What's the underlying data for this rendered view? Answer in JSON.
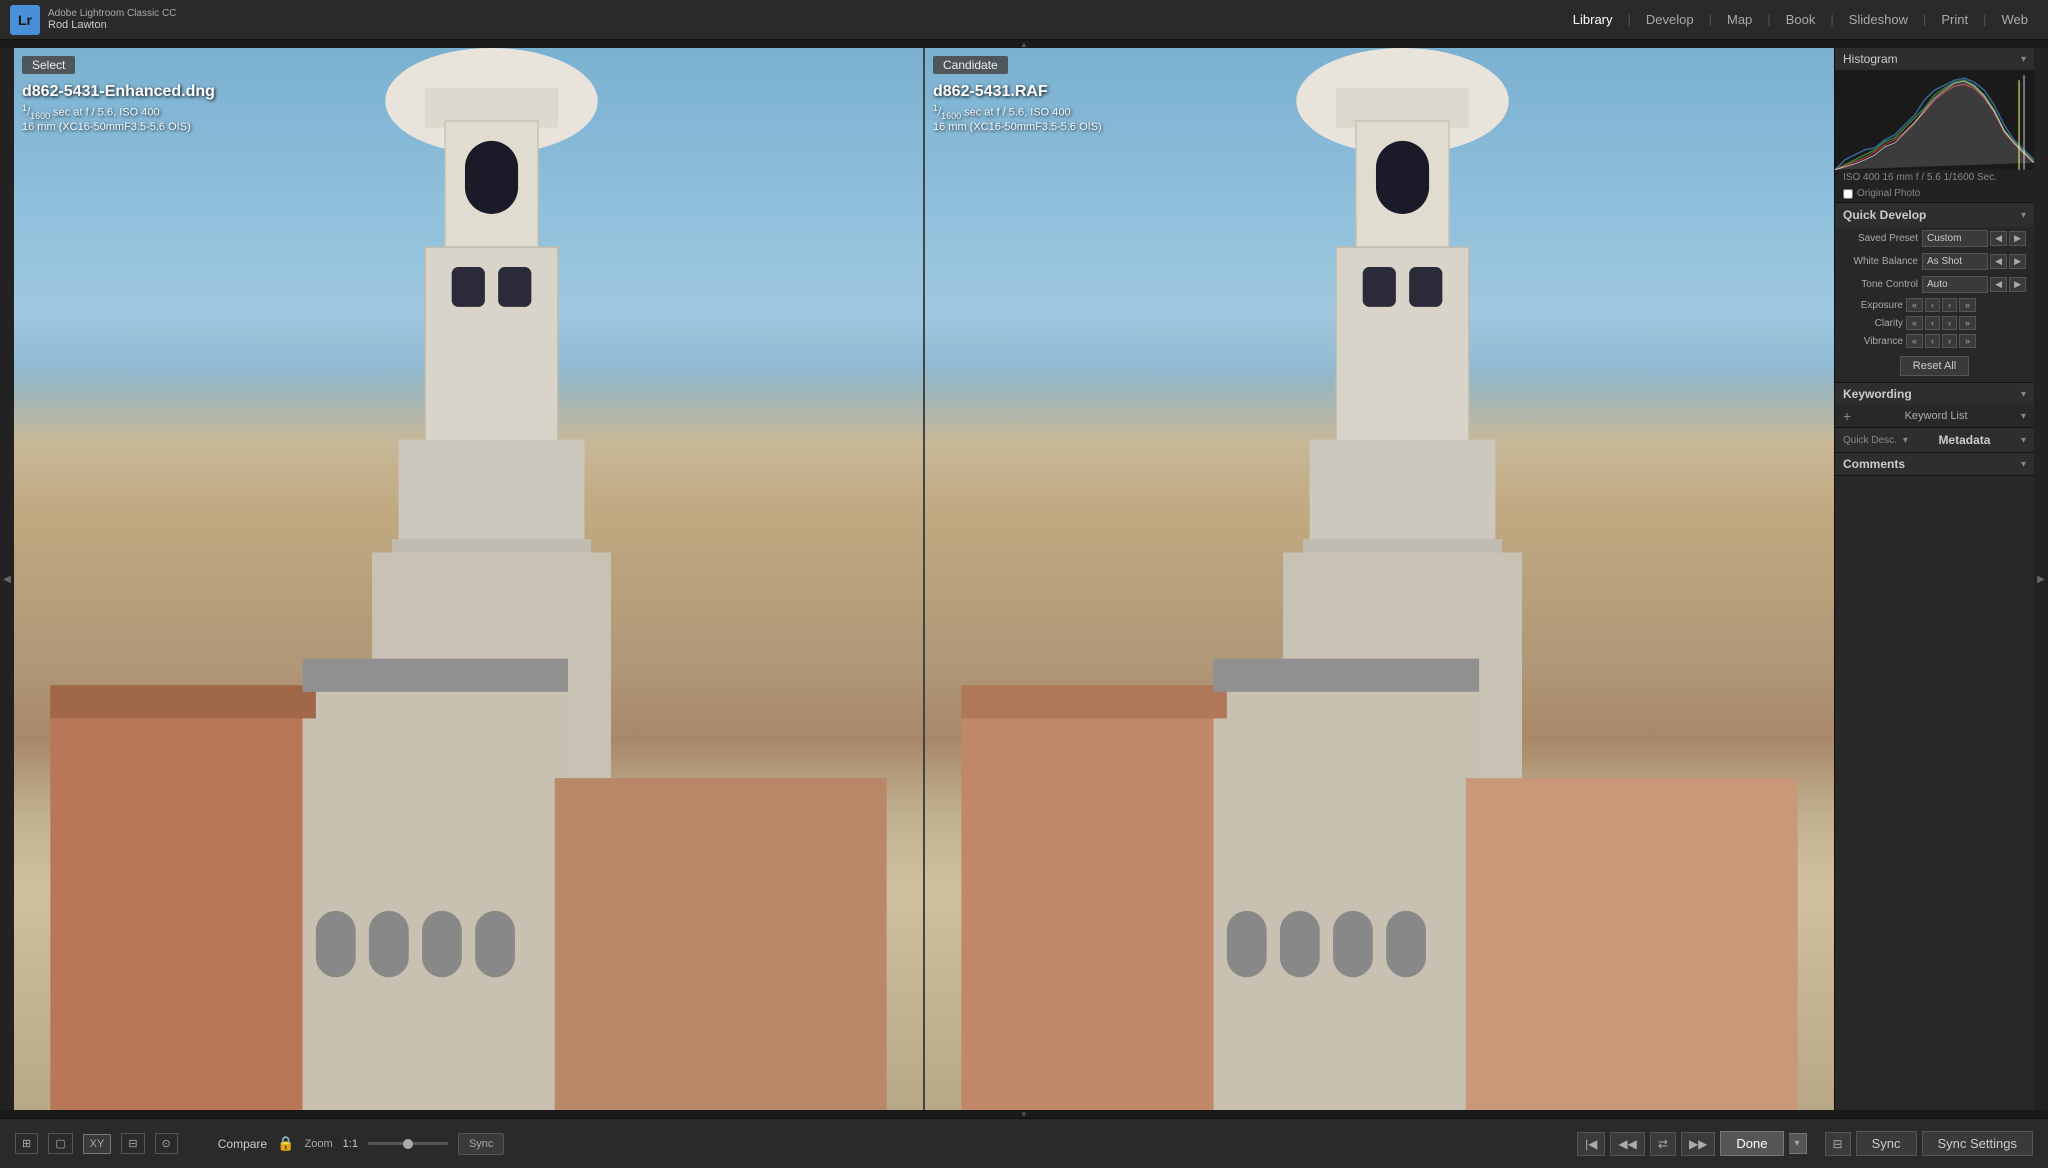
{
  "app": {
    "logo": "Lr",
    "app_name": "Adobe Lightroom Classic CC",
    "user_name": "Rod Lawton"
  },
  "nav": {
    "items": [
      "Library",
      "Develop",
      "Map",
      "Book",
      "Slideshow",
      "Print",
      "Web"
    ],
    "active": "Library"
  },
  "left_image": {
    "filename": "d862-5431-Enhanced.dng",
    "shutter": "1",
    "shutter_denom": "1600",
    "aperture": "f / 5.6",
    "iso": "ISO 400",
    "lens": "16 mm (XC16-50mmF3.5-5.6 OIS)",
    "badge": "Select"
  },
  "right_image": {
    "filename": "d862-5431.RAF",
    "shutter": "1",
    "shutter_denom": "1600",
    "aperture": "f / 5.6",
    "iso": "ISO 400",
    "lens": "16 mm (XC16-50mmF3.5-5.6 OIS)",
    "badge": "Candidate"
  },
  "histogram": {
    "title": "Histogram",
    "meta": "ISO 400   16 mm   f / 5.6   1/1600 Sec.",
    "original_photo_label": "Original Photo"
  },
  "quick_develop": {
    "title": "Quick Develop",
    "saved_preset_label": "Saved Preset",
    "saved_preset_value": "Custom",
    "white_balance_label": "White Balance",
    "white_balance_value": "As Shot",
    "tone_control_label": "Tone Control",
    "tone_control_value": "Auto",
    "exposure_label": "Exposure",
    "clarity_label": "Clarity",
    "vibrance_label": "Vibrance",
    "reset_all": "Reset All",
    "btn_minus2": "«",
    "btn_minus1": "‹",
    "btn_plus1": "›",
    "btn_plus2": "»"
  },
  "keywording": {
    "title": "Keywording",
    "add_icon": "+",
    "keyword_list_label": "Keyword List"
  },
  "metadata": {
    "title": "Metadata",
    "quick_desc_label": "Quick Desc.",
    "expand_icon": "▾"
  },
  "comments": {
    "title": "Comments",
    "expand_icon": "▾"
  },
  "toolbar": {
    "compare_label": "Compare",
    "zoom_label": "Zoom",
    "zoom_value": "1:1",
    "sync_label": "Sync",
    "done_label": "Done",
    "sync_main": "Sync",
    "sync_settings": "Sync Settings"
  },
  "bottom_tools": {
    "grid_icon": "⊞",
    "filmstrip_icon": "▤",
    "xy_icon": "XY",
    "compare_icon": "⧉",
    "survey_icon": "⊟"
  }
}
